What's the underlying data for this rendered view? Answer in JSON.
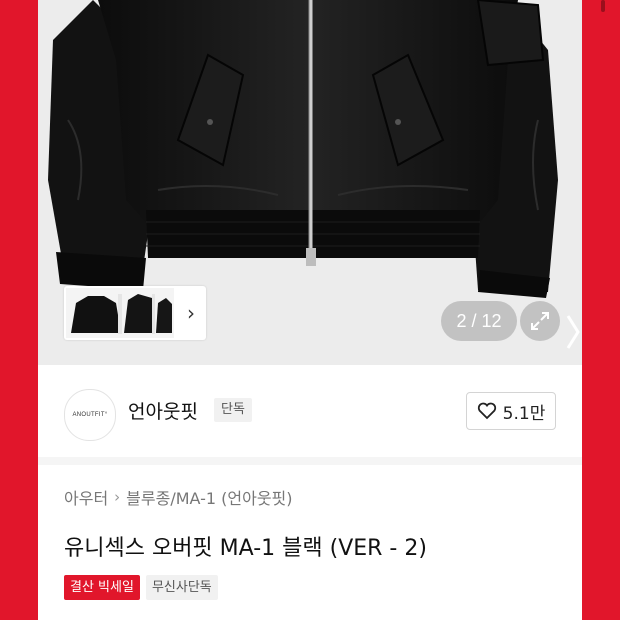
{
  "gallery": {
    "counter": "2 / 12",
    "thumb_arrow": "›"
  },
  "brand": {
    "logo_text": "ANOUTFIT°",
    "name": "언아웃핏",
    "badge": "단독",
    "likes": "5.1만"
  },
  "product": {
    "breadcrumb": [
      "아우터",
      "블루종/MA-1 (언아웃핏)"
    ],
    "title": "유니섹스 오버핏 MA-1 블랙 (VER - 2)",
    "tags": [
      "결산 빅세일",
      "무신사단독"
    ]
  },
  "colors": {
    "accent_red": "#e1162b",
    "jacket": "#141414"
  },
  "icons": [
    "expand-icon",
    "heart-icon",
    "chevron-right-icon"
  ]
}
